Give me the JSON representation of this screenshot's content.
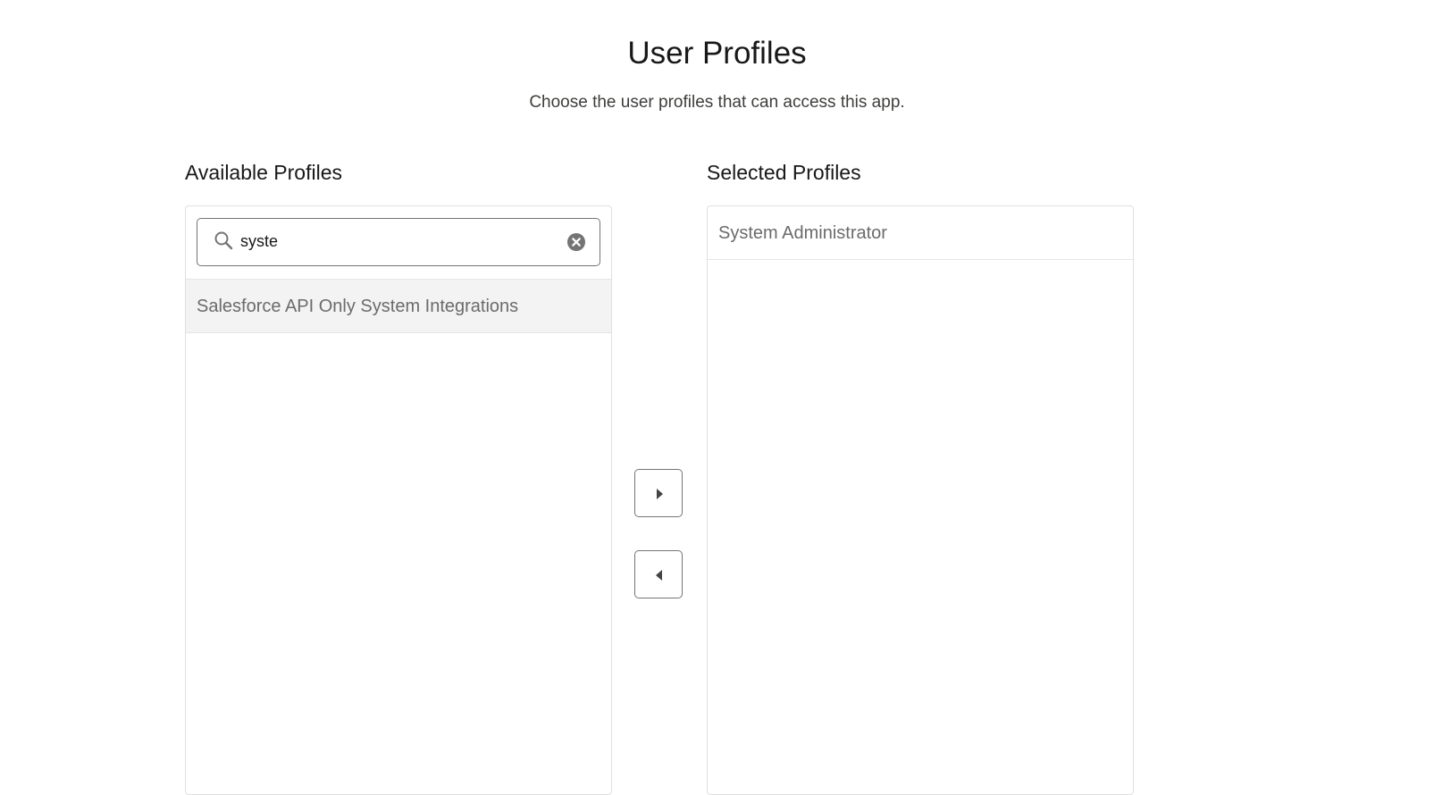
{
  "header": {
    "title": "User Profiles",
    "subtitle": "Choose the user profiles that can access this app."
  },
  "available": {
    "heading": "Available Profiles",
    "search": {
      "value": "syste",
      "placeholder": "",
      "icon": "search-icon",
      "clear_icon": "clear-icon"
    },
    "items": [
      {
        "label": "Salesforce API Only System Integrations",
        "highlighted": true
      }
    ]
  },
  "selected": {
    "heading": "Selected Profiles",
    "items": [
      {
        "label": "System Administrator"
      }
    ]
  },
  "controls": {
    "move_right_icon": "caret-right-icon",
    "move_left_icon": "caret-left-icon"
  },
  "colors": {
    "border": "#747474",
    "highlight_bg": "#f3f3f3",
    "icon_gray": "#747474",
    "option_text": "#6b6b6b"
  }
}
